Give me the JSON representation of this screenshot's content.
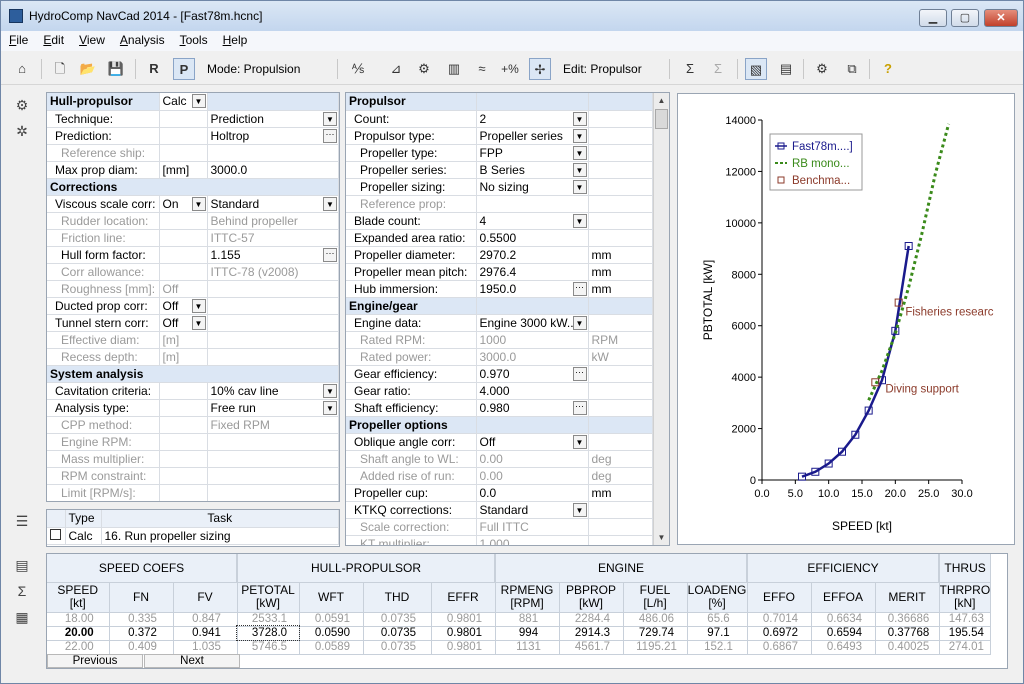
{
  "window": {
    "title": "HydroComp NavCad 2014 - [Fast78m.hcnc]",
    "min": "▁",
    "max": "▢",
    "close": "✕"
  },
  "menu": [
    {
      "pre": "",
      "u": "F",
      "post": "ile"
    },
    {
      "pre": "",
      "u": "E",
      "post": "dit"
    },
    {
      "pre": "",
      "u": "V",
      "post": "iew"
    },
    {
      "pre": "",
      "u": "A",
      "post": "nalysis"
    },
    {
      "pre": "",
      "u": "T",
      "post": "ools"
    },
    {
      "pre": "",
      "u": "H",
      "post": "elp"
    }
  ],
  "toolbar": {
    "mode_label": "Mode: Propulsion",
    "edit_label": "Edit: Propulsor",
    "pct": "+%"
  },
  "hull": {
    "header": "Hull-propulsor",
    "header_value": "Calc",
    "rows": [
      {
        "label": "Technique:",
        "value": "Prediction",
        "kind": "dd",
        "indent": 1
      },
      {
        "label": "Prediction:",
        "value": "Holtrop",
        "kind": "el",
        "indent": 1
      },
      {
        "label": "Reference ship:",
        "value": "",
        "kind": "dis",
        "indent": 2
      },
      {
        "label": "Max prop diam:",
        "unit": "[mm]",
        "value": "3000.0",
        "kind": "unit",
        "indent": 1
      },
      {
        "label": "Corrections",
        "kind": "section"
      },
      {
        "label": "Viscous scale corr:",
        "unit": "On",
        "value": "Standard",
        "kind": "dd2",
        "indent": 1
      },
      {
        "label": "Rudder location:",
        "value": "Behind propeller",
        "kind": "disv",
        "indent": 2
      },
      {
        "label": "Friction line:",
        "value": "ITTC-57",
        "kind": "disv",
        "indent": 2
      },
      {
        "label": "Hull form factor:",
        "value": "1.155",
        "kind": "el",
        "indent": 2
      },
      {
        "label": "Corr allowance:",
        "value": "ITTC-78 (v2008)",
        "kind": "disv",
        "indent": 2
      },
      {
        "label": "Roughness [mm]:",
        "unit": "Off",
        "value": "",
        "kind": "disu",
        "indent": 2
      },
      {
        "label": "Ducted prop corr:",
        "unit": "Off",
        "value": "",
        "kind": "dd1",
        "indent": 1
      },
      {
        "label": "Tunnel stern corr:",
        "unit": "Off",
        "value": "",
        "kind": "dd1",
        "indent": 1
      },
      {
        "label": "Effective diam:",
        "unit": "[m]",
        "value": "",
        "kind": "disu",
        "indent": 2
      },
      {
        "label": "Recess depth:",
        "unit": "[m]",
        "value": "",
        "kind": "disu",
        "indent": 2
      },
      {
        "label": "System analysis",
        "kind": "section"
      },
      {
        "label": "Cavitation criteria:",
        "value": "10% cav line",
        "kind": "dd",
        "indent": 1
      },
      {
        "label": "Analysis type:",
        "value": "Free run",
        "kind": "dd",
        "indent": 1
      },
      {
        "label": "CPP method:",
        "value": "Fixed RPM",
        "kind": "disv",
        "indent": 2
      },
      {
        "label": "Engine RPM:",
        "value": "",
        "kind": "dis",
        "indent": 2
      },
      {
        "label": "Mass multiplier:",
        "value": "",
        "kind": "dis",
        "indent": 2
      },
      {
        "label": "RPM constraint:",
        "value": "",
        "kind": "dis",
        "indent": 2
      },
      {
        "label": "Limit [RPM/s]:",
        "value": "",
        "kind": "dis",
        "indent": 3
      }
    ]
  },
  "tasks": {
    "col_type": "Type",
    "col_task": "Task",
    "rows": [
      {
        "type": "Calc",
        "task": "16. Run propeller sizing"
      }
    ]
  },
  "propulsor": {
    "rows": [
      {
        "label": "Propulsor",
        "kind": "section"
      },
      {
        "label": "Count:",
        "value": "2",
        "kind": "dd",
        "indent": 1
      },
      {
        "label": "Propulsor type:",
        "value": "Propeller series",
        "kind": "dd",
        "indent": 1
      },
      {
        "label": "Propeller type:",
        "value": "FPP",
        "kind": "dd",
        "indent": 2
      },
      {
        "label": "Propeller series:",
        "value": "B Series",
        "kind": "dd",
        "indent": 2
      },
      {
        "label": "Propeller sizing:",
        "value": "No sizing",
        "kind": "dd",
        "indent": 2
      },
      {
        "label": "Reference prop:",
        "value": "",
        "kind": "dis",
        "indent": 2
      },
      {
        "label": "Blade count:",
        "value": "4",
        "kind": "dd",
        "indent": 1
      },
      {
        "label": "Expanded area ratio:",
        "value": "0.5500",
        "kind": "text",
        "indent": 1
      },
      {
        "label": "Propeller diameter:",
        "value": "2970.2",
        "unit": "mm",
        "kind": "text",
        "indent": 1
      },
      {
        "label": "Propeller mean pitch:",
        "value": "2976.4",
        "unit": "mm",
        "kind": "text",
        "indent": 1
      },
      {
        "label": "Hub immersion:",
        "value": "1950.0",
        "unit": "mm",
        "kind": "el",
        "indent": 1
      },
      {
        "label": "Engine/gear",
        "kind": "section"
      },
      {
        "label": "Engine data:",
        "value": "Engine 3000 kW...",
        "kind": "dd",
        "indent": 1
      },
      {
        "label": "Rated RPM:",
        "value": "1000",
        "unit": "RPM",
        "kind": "disv",
        "indent": 2
      },
      {
        "label": "Rated power:",
        "value": "3000.0",
        "unit": "kW",
        "kind": "disv",
        "indent": 2
      },
      {
        "label": "Gear efficiency:",
        "value": "0.970",
        "kind": "el",
        "indent": 1
      },
      {
        "label": "Gear ratio:",
        "value": "4.000",
        "kind": "text",
        "indent": 1
      },
      {
        "label": "Shaft efficiency:",
        "value": "0.980",
        "kind": "el",
        "indent": 1
      },
      {
        "label": "Propeller options",
        "kind": "section"
      },
      {
        "label": "Oblique angle corr:",
        "value": "Off",
        "kind": "dd",
        "indent": 1
      },
      {
        "label": "Shaft angle to WL:",
        "value": "0.00",
        "unit": "deg",
        "kind": "disv",
        "indent": 2
      },
      {
        "label": "Added rise of run:",
        "value": "0.00",
        "unit": "deg",
        "kind": "disv",
        "indent": 2
      },
      {
        "label": "Propeller cup:",
        "value": "0.0",
        "unit": "mm",
        "kind": "text",
        "indent": 1
      },
      {
        "label": "KTKQ corrections:",
        "value": "Standard",
        "kind": "dd",
        "indent": 1
      },
      {
        "label": "Scale correction:",
        "value": "Full ITTC",
        "kind": "disv",
        "indent": 2
      },
      {
        "label": "KT multiplier:",
        "value": "1.000",
        "kind": "disv",
        "indent": 2
      }
    ]
  },
  "chart_data": {
    "type": "line",
    "xlabel": "SPEED [kt]",
    "ylabel": "PBTOTAL [kW]",
    "xlim": [
      0,
      30
    ],
    "ylim": [
      0,
      14000
    ],
    "xticks": [
      "0.0",
      "5.0",
      "10.0",
      "15.0",
      "20.0",
      "25.0",
      "30.0"
    ],
    "yticks": [
      "0",
      "2000",
      "4000",
      "6000",
      "8000",
      "10000",
      "12000",
      "14000"
    ],
    "legend_position": "top-left",
    "series": [
      {
        "name": "Fast78m....]",
        "style": "solid-squares",
        "color": "#1a1a8c",
        "x": [
          6,
          8,
          10,
          12,
          14,
          16,
          18,
          20,
          22
        ],
        "y": [
          130,
          320,
          640,
          1100,
          1760,
          2700,
          3880,
          5800,
          9100
        ]
      },
      {
        "name": "RB mono...",
        "style": "dotted",
        "color": "#3a8a1a",
        "x": [
          16,
          18,
          20,
          22,
          24,
          26,
          28
        ],
        "y": [
          3100,
          4250,
          5700,
          7500,
          9600,
          11900,
          13850
        ]
      },
      {
        "name": "Benchma...",
        "style": "squares",
        "color": "#8b3a2a",
        "x": [
          17,
          20.5
        ],
        "y": [
          3800,
          6900
        ]
      }
    ],
    "annotations": [
      {
        "text": "Fisheries researc",
        "x": 21.5,
        "y": 6400
      },
      {
        "text": "Diving support",
        "x": 18.5,
        "y": 3400
      }
    ]
  },
  "results": {
    "groups": [
      {
        "label": "SPEED COEFS",
        "span": 3
      },
      {
        "label": "HULL-PROPULSOR",
        "span": 4
      },
      {
        "label": "ENGINE",
        "span": 4
      },
      {
        "label": "EFFICIENCY",
        "span": 3
      },
      {
        "label": "THRUS",
        "span": 1
      }
    ],
    "columns": [
      {
        "name": "SPEED",
        "unit": "[kt]"
      },
      {
        "name": "FN",
        "unit": ""
      },
      {
        "name": "FV",
        "unit": ""
      },
      {
        "name": "PETOTAL",
        "unit": "[kW]"
      },
      {
        "name": "WFT",
        "unit": ""
      },
      {
        "name": "THD",
        "unit": ""
      },
      {
        "name": "EFFR",
        "unit": ""
      },
      {
        "name": "RPMENG",
        "unit": "[RPM]"
      },
      {
        "name": "PBPROP",
        "unit": "[kW]"
      },
      {
        "name": "FUEL",
        "unit": "[L/h]"
      },
      {
        "name": "LOADENG",
        "unit": "[%]"
      },
      {
        "name": "EFFO",
        "unit": ""
      },
      {
        "name": "EFFOA",
        "unit": ""
      },
      {
        "name": "MERIT",
        "unit": ""
      },
      {
        "name": "THRPRO",
        "unit": "[kN]"
      }
    ],
    "rows": [
      {
        "cells": [
          "18.00",
          "0.335",
          "0.847",
          "2533.1",
          "0.0591",
          "0.0735",
          "0.9801",
          "881",
          "2284.4",
          "486.06",
          "65.6",
          "0.7014",
          "0.6634",
          "0.36686",
          "147.63"
        ],
        "state": "dim"
      },
      {
        "cells": [
          "20.00",
          "0.372",
          "0.941",
          "3728.0",
          "0.0590",
          "0.0735",
          "0.9801",
          "994",
          "2914.3",
          "729.74",
          "97.1",
          "0.6972",
          "0.6594",
          "0.37768",
          "195.54"
        ],
        "state": "cur"
      },
      {
        "cells": [
          "22.00",
          "0.409",
          "1.035",
          "5746.5",
          "0.0589",
          "0.0735",
          "0.9801",
          "1131",
          "4561.7",
          "1195.21",
          "152.1",
          "0.6867",
          "0.6493",
          "0.40025",
          "274.01"
        ],
        "state": "dim"
      }
    ],
    "prev_label": "Previous",
    "next_label": "Next"
  }
}
